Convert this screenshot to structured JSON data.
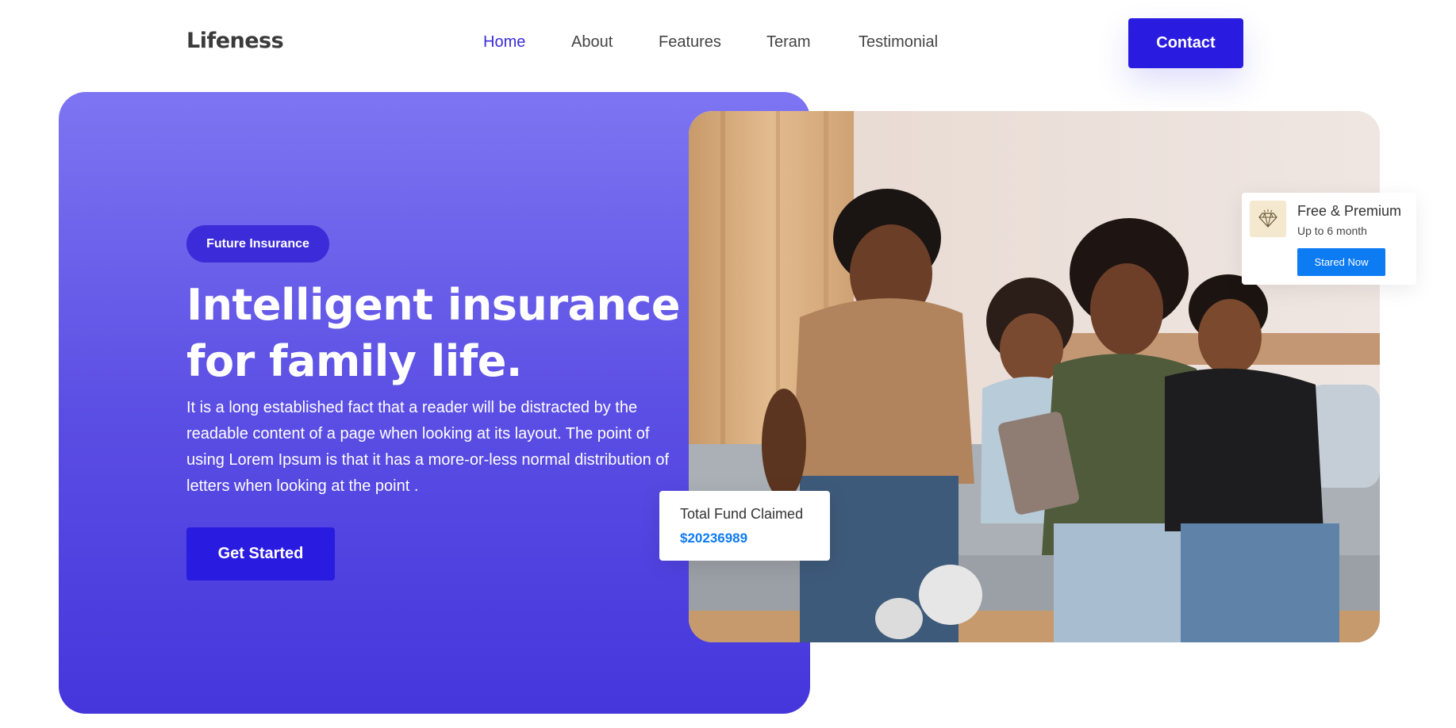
{
  "brand": {
    "logo": "Lifeness"
  },
  "nav": {
    "items": [
      {
        "label": "Home",
        "active": true
      },
      {
        "label": "About"
      },
      {
        "label": "Features"
      },
      {
        "label": "Teram"
      },
      {
        "label": "Testimonial"
      }
    ],
    "contact_label": "Contact"
  },
  "hero": {
    "badge": "Future Insurance",
    "headline_line1": "Intelligent insurance",
    "headline_line2": "for family life.",
    "body": "It is a long established fact that a reader will be distracted by the readable content of a page when looking at its layout. The point of using Lorem Ipsum is that it has a more-or-less normal distribution of letters when looking at the point .",
    "cta_label": "Get Started"
  },
  "premium_card": {
    "icon": "diamond-icon",
    "title": "Free & Premium",
    "subtitle": "Up to 6 month",
    "button_label": "Stared Now"
  },
  "fund_card": {
    "label": "Total Fund Claimed",
    "value": "$20236989"
  },
  "colors": {
    "primary": "#2a1be0",
    "accent_blue": "#0d7bf2",
    "gradient_top": "#7d75f2",
    "gradient_bottom": "#4536dc"
  }
}
